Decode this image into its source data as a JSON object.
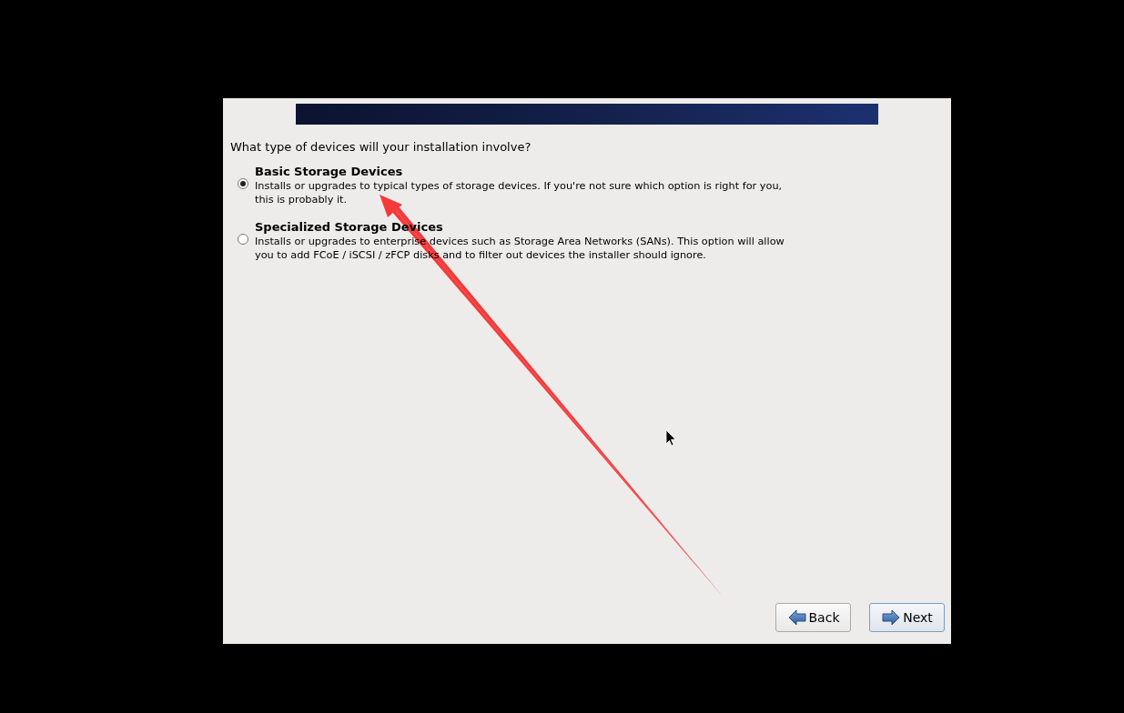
{
  "question": "What type of devices will your installation involve?",
  "options": [
    {
      "kind": "radio",
      "title": "Basic Storage Devices",
      "description": "Installs or upgrades to typical types of storage devices.  If you're not sure which option is right for you, this is probably it.",
      "selected": true
    },
    {
      "kind": "radio",
      "title": "Specialized Storage Devices",
      "description": "Installs or upgrades to enterprise devices such as Storage Area Networks (SANs). This option will allow you to add FCoE / iSCSI / zFCP disks and to filter out devices the installer should ignore.",
      "selected": false
    }
  ],
  "buttons": [
    {
      "kind": "back",
      "label": "Back",
      "default": false
    },
    {
      "kind": "next",
      "label": "Next",
      "default": true
    }
  ]
}
